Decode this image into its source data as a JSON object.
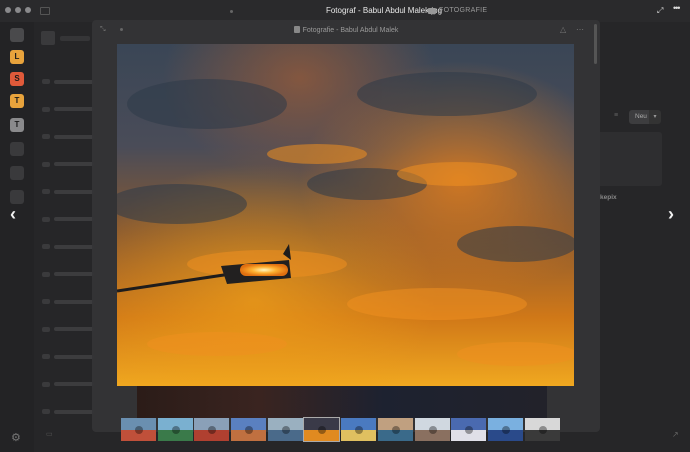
{
  "titlebar": {
    "title": "Fotograf - Babul Abdul Malek.jpg",
    "folder_label": "FOTOGRAFIE",
    "expand_icon": "expand-icon",
    "more_icon": "more-icon"
  },
  "dock": {
    "items": [
      {
        "letter": "",
        "color": "#4a4a4c"
      },
      {
        "letter": "L",
        "color": "#e8a33c"
      },
      {
        "letter": "S",
        "color": "#e05a3a"
      },
      {
        "letter": "T",
        "color": "#e8a33c"
      },
      {
        "letter": "T",
        "color": "#8a8a8c"
      },
      {
        "letter": "",
        "color": "#3a3a3c"
      },
      {
        "letter": "",
        "color": "#3a3a3c"
      },
      {
        "letter": "",
        "color": "#3a3a3c"
      }
    ]
  },
  "background": {
    "sort_button": "Neu",
    "card_label": "kepix"
  },
  "viewer": {
    "title": "Fotografie - Babul Abdul Malek",
    "prev_icon": "chevron-left-icon",
    "next_icon": "chevron-right-icon"
  },
  "filmstrip": {
    "selected_index": 5,
    "thumbs": [
      {
        "c1": "#6a8fb0",
        "c2": "#c0503a"
      },
      {
        "c1": "#7ab0d0",
        "c2": "#3a7a4a"
      },
      {
        "c1": "#8aa0b8",
        "c2": "#b04030"
      },
      {
        "c1": "#5a80c0",
        "c2": "#c07040"
      },
      {
        "c1": "#9ab0c0",
        "c2": "#4a6a8a"
      },
      {
        "c1": "#3a3a48",
        "c2": "#e08a20"
      },
      {
        "c1": "#4a7ac0",
        "c2": "#e0c060"
      },
      {
        "c1": "#c0a080",
        "c2": "#3a6a8a"
      },
      {
        "c1": "#d0d8e0",
        "c2": "#8a7060"
      },
      {
        "c1": "#4a6ab0",
        "c2": "#e0e0e8"
      },
      {
        "c1": "#7ab0e0",
        "c2": "#2a4a8a"
      },
      {
        "c1": "#d8d8d8",
        "c2": "#3a3a3a"
      }
    ]
  }
}
